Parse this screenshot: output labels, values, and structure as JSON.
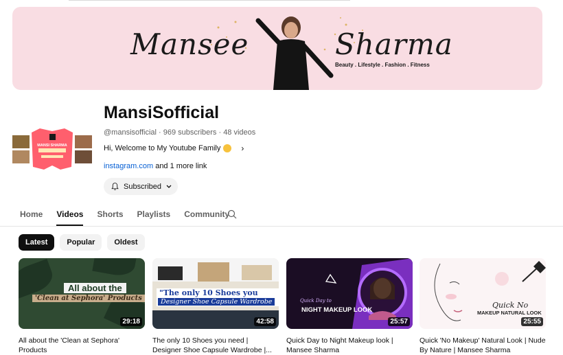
{
  "banner": {
    "name_left": "Mansee",
    "name_right": "Sharma",
    "tagline": "Beauty . Lifestyle . Fashion . Fitness"
  },
  "avatar": {
    "title": "MANSI SHARMA"
  },
  "channel": {
    "name": "MansiSofficial",
    "meta": "@mansisofficial · 969 subscribers · 48 videos",
    "description": "Hi, Welcome to My Youtube Family",
    "link": "instagram.com",
    "more_links": " and 1 more link",
    "subscribe_label": "Subscribed"
  },
  "tabs": [
    {
      "label": "Home"
    },
    {
      "label": "Videos"
    },
    {
      "label": "Shorts"
    },
    {
      "label": "Playlists"
    },
    {
      "label": "Community"
    }
  ],
  "chips": [
    {
      "label": "Latest"
    },
    {
      "label": "Popular"
    },
    {
      "label": "Oldest"
    }
  ],
  "videos": [
    {
      "title": "All about the 'Clean at Sephora' Products",
      "duration": "29:18",
      "thumb_text1": "All about the",
      "thumb_text2": "'Clean at Sephora' Products"
    },
    {
      "title": "The only 10 Shoes you need | Designer Shoe Capsule Wardrobe |...",
      "duration": "42:58",
      "thumb_text1": "\"The only 10 Shoes you need\"",
      "thumb_text2": "Designer Shoe Capsule Wardrobe"
    },
    {
      "title": "Quick Day to Night Makeup look | Mansee Sharma",
      "duration": "25:57",
      "thumb_text1": "Quick Day to",
      "thumb_text2": "NIGHT MAKEUP LOOK"
    },
    {
      "title": "Quick 'No Makeup' Natural Look | Nude By Nature | Mansee Sharma",
      "duration": "25:55",
      "thumb_text1": "Quick No",
      "thumb_text2": "MAKEUP NATURAL LOOK"
    }
  ],
  "colors": {
    "accent_link": "#065fd4",
    "banner_bg": "#f9dde3"
  }
}
